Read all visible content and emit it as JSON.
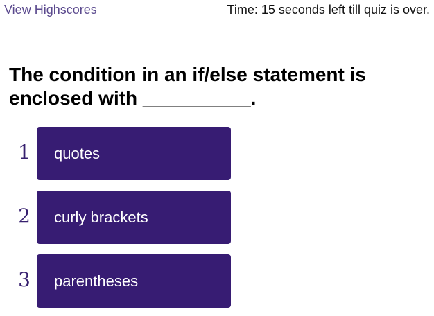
{
  "header": {
    "highscores_link": "View Highscores",
    "timer_text": "Time: 15 seconds left till quiz is over."
  },
  "question": {
    "text": "The condition in an if/else statement is enclosed with __________."
  },
  "choices": [
    {
      "number": "1",
      "label": "quotes"
    },
    {
      "number": "2",
      "label": "curly brackets"
    },
    {
      "number": "3",
      "label": "parentheses"
    }
  ],
  "colors": {
    "button_bg": "#371c73",
    "number_text": "#37206f",
    "link": "#5b4a8e"
  }
}
